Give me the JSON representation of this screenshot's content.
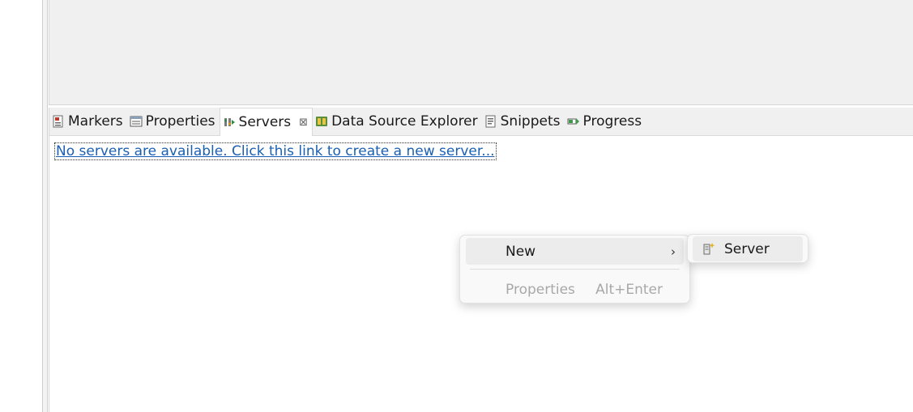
{
  "tabs": [
    {
      "label": "Markers",
      "icon": "markers-icon"
    },
    {
      "label": "Properties",
      "icon": "properties-icon"
    },
    {
      "label": "Servers",
      "icon": "servers-icon",
      "active": true
    },
    {
      "label": "Data Source Explorer",
      "icon": "data-source-explorer-icon"
    },
    {
      "label": "Snippets",
      "icon": "snippets-icon"
    },
    {
      "label": "Progress",
      "icon": "progress-icon"
    }
  ],
  "servers_view": {
    "empty_link": "No servers are available. Click this link to create a new server..."
  },
  "context_menu": {
    "new_label": "New",
    "properties_label": "Properties",
    "properties_accel": "Alt+Enter"
  },
  "submenu": {
    "server_label": "Server"
  },
  "colors": {
    "link": "#1a5fb4",
    "disabled_text": "#a8a8a8",
    "panel_bg": "#f0f0f0"
  }
}
